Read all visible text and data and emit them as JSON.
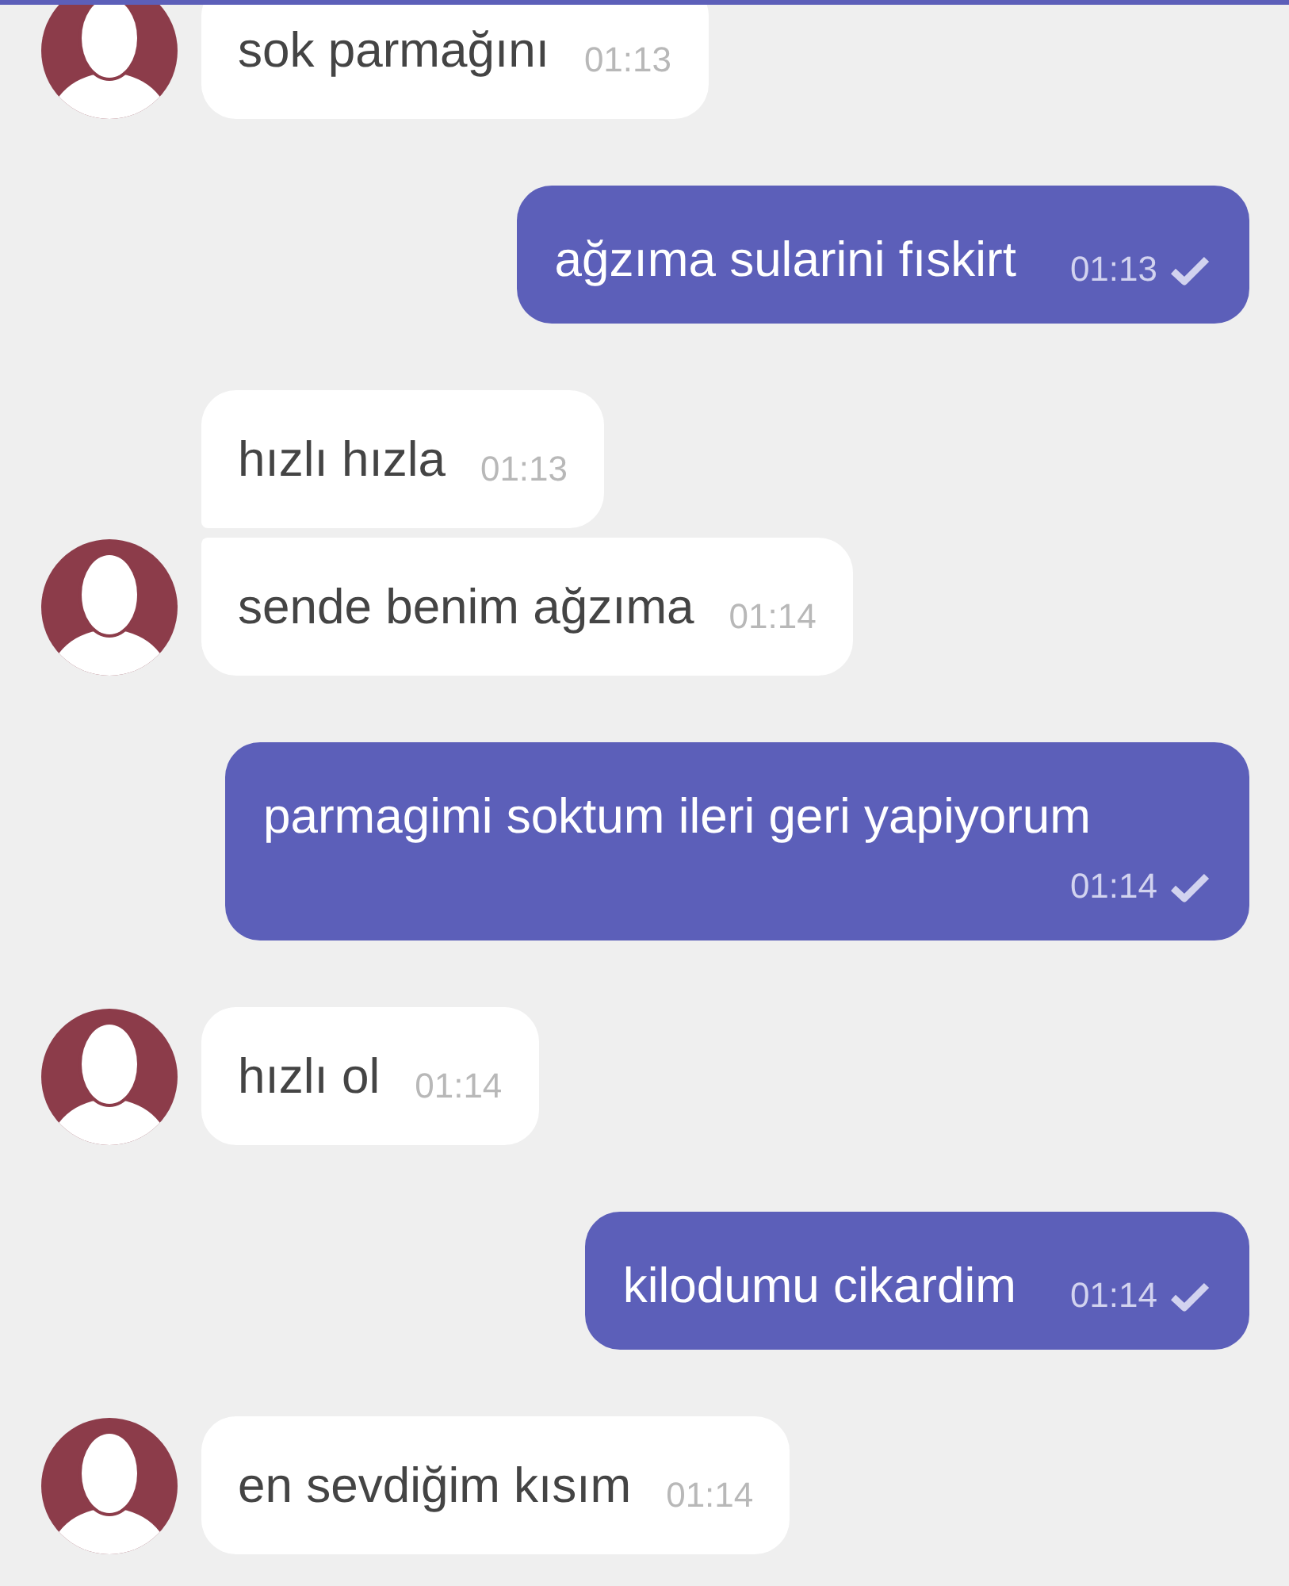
{
  "messages": [
    {
      "kind": "incoming",
      "text": "sok parmağını",
      "time": "01:13",
      "avatar": true
    },
    {
      "kind": "outgoing",
      "text": "ağzıma sularini fıskirt",
      "time": "01:13",
      "delivered": true
    },
    {
      "kind": "incoming",
      "text": "hızlı hızla",
      "time": "01:13",
      "avatar": false
    },
    {
      "kind": "incoming",
      "text": "sende benim ağzıma",
      "time": "01:14",
      "avatar": true
    },
    {
      "kind": "outgoing",
      "text": "parmagimi soktum ileri geri yapiyorum",
      "time": "01:14",
      "delivered": true
    },
    {
      "kind": "incoming",
      "text": "hızlı ol",
      "time": "01:14",
      "avatar": true
    },
    {
      "kind": "outgoing",
      "text": "kilodumu cikardim",
      "time": "01:14",
      "delivered": true
    },
    {
      "kind": "incoming",
      "text": "en sevdiğim kısım",
      "time": "01:14",
      "avatar": true
    }
  ]
}
